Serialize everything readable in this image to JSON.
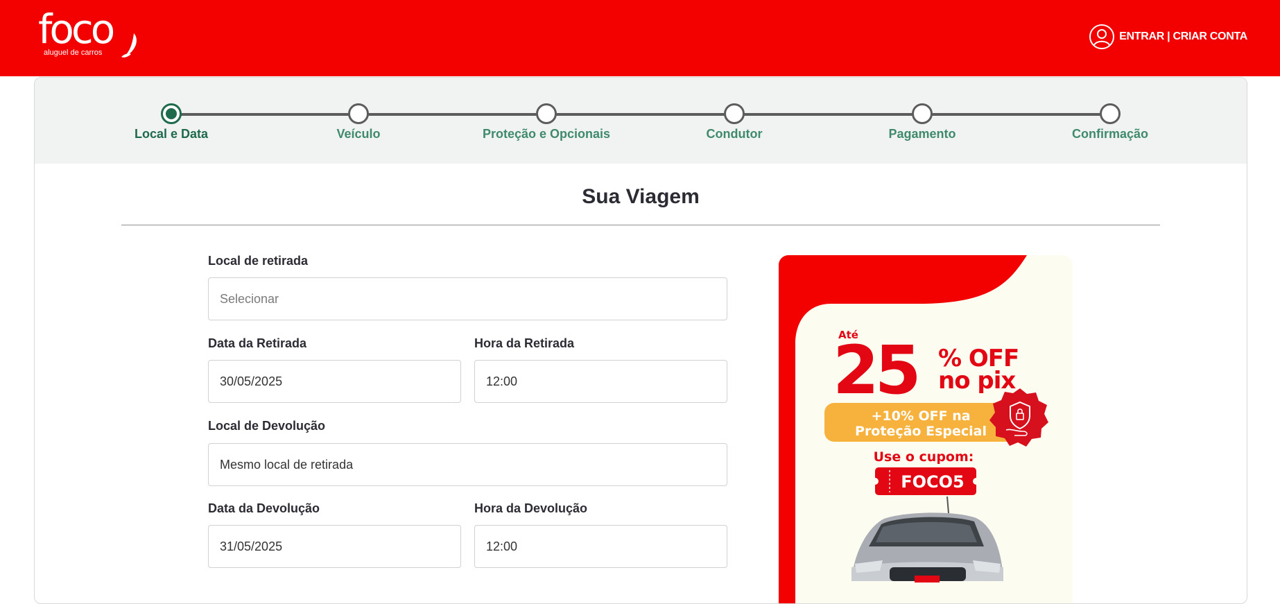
{
  "header": {
    "logo_word": "foco",
    "logo_tagline": "aluguel de carros",
    "account_label": "ENTRAR | CRIAR CONTA"
  },
  "stepper": {
    "steps": [
      {
        "label": "Local e Data",
        "active": true
      },
      {
        "label": "Veículo",
        "active": false
      },
      {
        "label": "Proteção e Opcionais",
        "active": false
      },
      {
        "label": "Condutor",
        "active": false
      },
      {
        "label": "Pagamento",
        "active": false
      },
      {
        "label": "Confirmação",
        "active": false
      }
    ]
  },
  "page_title": "Sua Viagem",
  "form": {
    "pickup_location": {
      "label": "Local de retirada",
      "placeholder": "Selecionar"
    },
    "pickup_date": {
      "label": "Data da Retirada",
      "value": "30/05/2025"
    },
    "pickup_time": {
      "label": "Hora da Retirada",
      "value": "12:00"
    },
    "return_location": {
      "label": "Local de Devolução",
      "value": "Mesmo local de retirada"
    },
    "return_date": {
      "label": "Data da Devolução",
      "value": "31/05/2025"
    },
    "return_time": {
      "label": "Hora da Devolução",
      "value": "12:00"
    }
  },
  "promo": {
    "prefix": "Até",
    "percent": "25",
    "off_line1": "% OFF",
    "off_line2": "no pix",
    "ribbon_line1": "+10% OFF na",
    "ribbon_line2": "Proteção Especial",
    "coupon_label": "Use o cupom:",
    "coupon_code": "FOCO5"
  },
  "colors": {
    "brand_red": "#f30000",
    "step_green": "#1e6a4c",
    "step_label_green": "#3f8a6d",
    "promo_orange": "#f6b23d"
  }
}
